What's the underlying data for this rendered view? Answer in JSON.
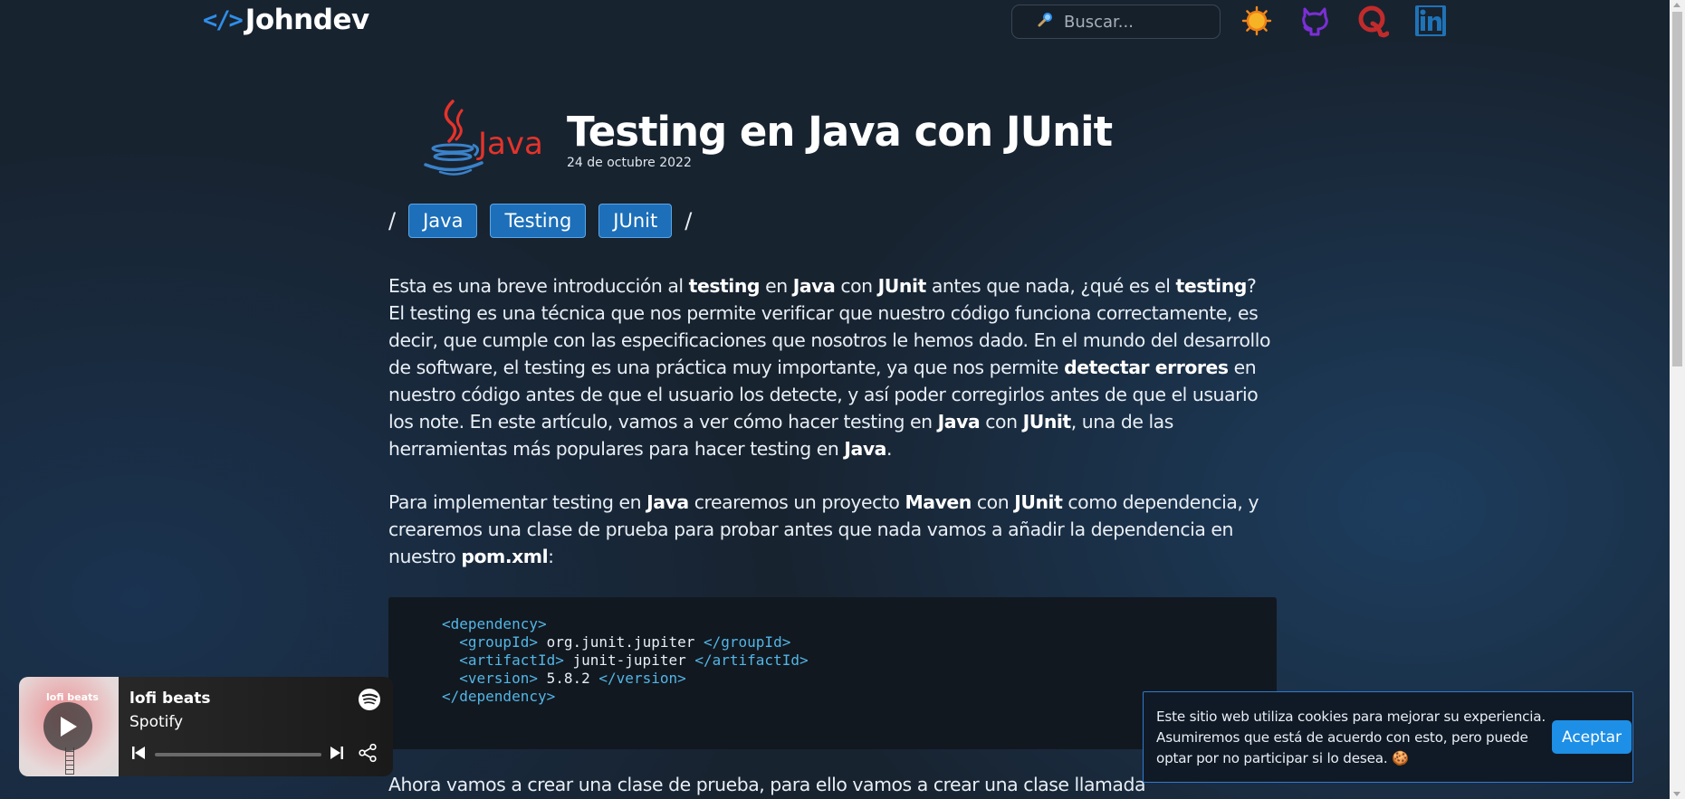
{
  "header": {
    "logo_mark": "</>",
    "logo_text": "Johndev",
    "search_placeholder": "Buscar...",
    "icons": [
      "theme-sun-icon",
      "github-icon",
      "quora-icon",
      "linkedin-icon"
    ]
  },
  "article": {
    "logo_text": "Java",
    "title": "Testing en Java con JUnit",
    "date": "24 de octubre 2022",
    "tags": [
      "Java",
      "Testing",
      "JUnit"
    ],
    "separator": "/",
    "p1": [
      {
        "t": "Esta es una breve introducción al "
      },
      {
        "t": "testing",
        "b": true
      },
      {
        "t": " en "
      },
      {
        "t": "Java",
        "b": true
      },
      {
        "t": " con "
      },
      {
        "t": "JUnit",
        "b": true
      },
      {
        "t": " antes que nada, ¿qué es el "
      },
      {
        "t": "testing",
        "b": true
      },
      {
        "t": "? El testing es una técnica que nos permite verificar que nuestro código funciona correctamente, es decir, que cumple con las especificaciones que nosotros le hemos dado. En el mundo del desarrollo de software, el testing es una práctica muy importante, ya que nos permite "
      },
      {
        "t": "detectar errores",
        "b": true
      },
      {
        "t": " en nuestro código antes de que el usuario los detecte, y así poder corregirlos antes de que el usuario los note. En este artículo, vamos a ver cómo hacer testing en "
      },
      {
        "t": "Java",
        "b": true
      },
      {
        "t": " con "
      },
      {
        "t": "JUnit",
        "b": true
      },
      {
        "t": ", una de las herramientas más populares para hacer testing en "
      },
      {
        "t": "Java",
        "b": true
      },
      {
        "t": "."
      }
    ],
    "p2": [
      {
        "t": "Para implementar testing en "
      },
      {
        "t": "Java",
        "b": true
      },
      {
        "t": " crearemos un proyecto "
      },
      {
        "t": "Maven",
        "b": true
      },
      {
        "t": " con "
      },
      {
        "t": "JUnit",
        "b": true
      },
      {
        "t": " como dependencia, y crearemos una clase de prueba para probar antes que nada vamos a añadir la dependencia en nuestro "
      },
      {
        "t": "pom.xml",
        "b": true
      },
      {
        "t": ":"
      }
    ],
    "code_lines": [
      [
        {
          "c": "tg",
          "t": "<dependency>"
        }
      ],
      [
        {
          "c": "tx",
          "t": "  "
        },
        {
          "c": "tg",
          "t": "<groupId>"
        },
        {
          "c": "tx",
          "t": " org.junit.jupiter "
        },
        {
          "c": "tg",
          "t": "</groupId>"
        }
      ],
      [
        {
          "c": "tx",
          "t": "  "
        },
        {
          "c": "tg",
          "t": "<artifactId>"
        },
        {
          "c": "tx",
          "t": " junit-jupiter "
        },
        {
          "c": "tg",
          "t": "</artifactId>"
        }
      ],
      [
        {
          "c": "tx",
          "t": "  "
        },
        {
          "c": "tg",
          "t": "<version>"
        },
        {
          "c": "tx",
          "t": " 5.8.2 "
        },
        {
          "c": "tg",
          "t": "</version>"
        }
      ],
      [
        {
          "c": "tg",
          "t": "</dependency>"
        }
      ]
    ],
    "p3": [
      {
        "t": "Ahora vamos a crear una clase de prueba, para ello vamos a crear una clase llamada"
      }
    ]
  },
  "spotify": {
    "cover_title": "lofi beats",
    "title": "lofi beats",
    "artist": "Spotify",
    "progress": 0
  },
  "cookie": {
    "text": "Este sitio web utiliza cookies para mejorar su experiencia. Asumiremos que está de acuerdo con esto, pero puede optar por no participar si lo desea. 🍪",
    "button": "Aceptar"
  },
  "colors": {
    "background": "#182330",
    "accent": "#1d6fb9",
    "logo_blue": "#2f8ee8",
    "code_tag": "#52b6e6",
    "cookie_button": "#1e8fe6"
  }
}
